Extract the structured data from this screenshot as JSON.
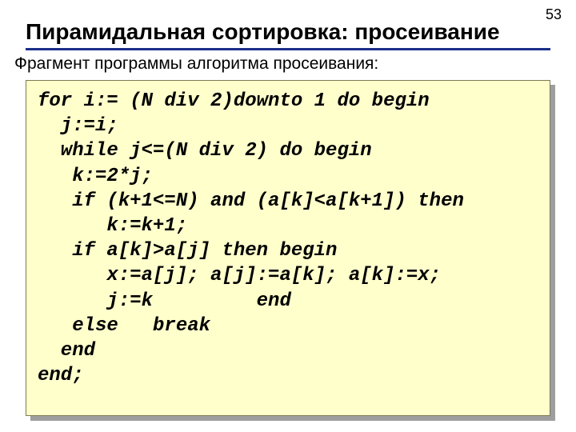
{
  "page_number": "53",
  "title": "Пирамидальная сортировка: просеивание",
  "subtitle": "Фрагмент программы алгоритма просеивания:",
  "code_lines": [
    "for i:= (N div 2)downto 1 do begin",
    "  j:=i;",
    "  while j<=(N div 2) do begin",
    "   k:=2*j;",
    "   if (k+1<=N) and (a[k]<a[k+1]) then",
    "      k:=k+1;",
    "   if a[k]>a[j] then begin",
    "      x:=a[j]; a[j]:=a[k]; a[k]:=x;",
    "      j:=k         end",
    "   else   break",
    "  end",
    "end;"
  ]
}
